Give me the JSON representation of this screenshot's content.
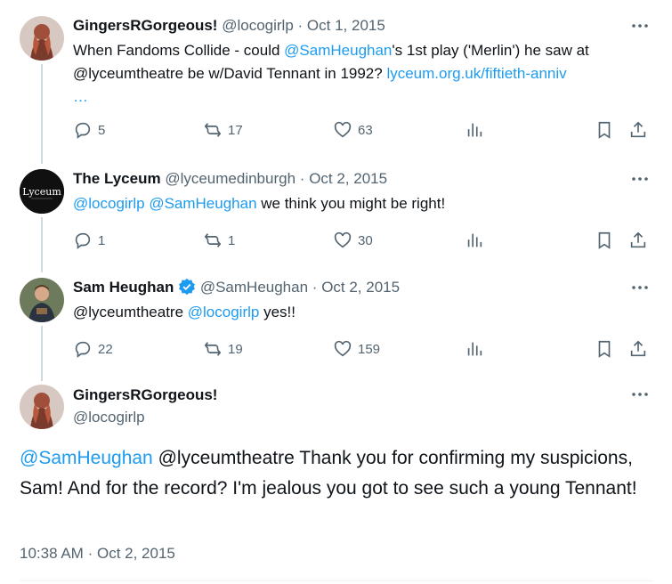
{
  "colors": {
    "link": "#1d9bf0",
    "muted": "#536471",
    "text": "#0f1419",
    "verified": "#1d9bf0"
  },
  "tweets": [
    {
      "name": "GingersRGorgeous!",
      "handle": "@locogirlp",
      "sep": "·",
      "date": "Oct 1, 2015",
      "text_1": "When Fandoms Collide - could ",
      "mention_1": "@SamHeughan",
      "text_2": "'s 1st play ('Merlin') he saw at @lyceumtheatre be w/David Tennant in 1992? ",
      "url": "lyceum.org.uk/fiftieth-anniv",
      "ellipsis": "…",
      "replies": "5",
      "retweets": "17",
      "likes": "63"
    },
    {
      "name": "The Lyceum",
      "handle": "@lyceumedinburgh",
      "sep": "·",
      "date": "Oct 2, 2015",
      "mention_1": "@locogirlp",
      "mention_2": "@SamHeughan",
      "text_1": " we think you might be right!",
      "replies": "1",
      "retweets": "1",
      "likes": "30",
      "avatar_text": "Lyceum"
    },
    {
      "name": "Sam Heughan",
      "handle": "@SamHeughan",
      "sep": "·",
      "date": "Oct 2, 2015",
      "text_1": "@lyceumtheatre ",
      "mention_1": "@locogirlp",
      "text_2": " yes!!",
      "replies": "22",
      "retweets": "19",
      "likes": "159"
    }
  ],
  "main": {
    "name": "GingersRGorgeous!",
    "handle": "@locogirlp",
    "mention": "@SamHeughan",
    "text": " @lyceumtheatre Thank you for confirming my suspicions, Sam! And for the record? I'm jealous you got to see such a young Tennant!",
    "time": "10:38 AM",
    "sep": "·",
    "date": "Oct 2, 2015"
  }
}
